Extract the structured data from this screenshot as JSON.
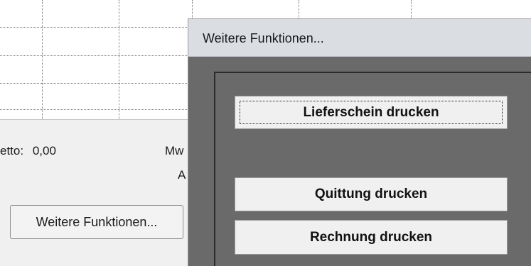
{
  "background": {
    "netto_label": "etto:",
    "netto_value": "0,00",
    "mwst_label": "Mw",
    "a_label": "A",
    "more_functions_button": "Weitere Funktionen..."
  },
  "dialog": {
    "title": "Weitere Funktionen...",
    "buttons": {
      "lieferschein": "Lieferschein drucken",
      "quittung": "Quittung drucken",
      "rechnung": "Rechnung drucken"
    }
  },
  "colors": {
    "dialog_body": "#6a6a6a",
    "dialog_titlebar": "#dadde2",
    "button_face": "#f0f0f0"
  }
}
